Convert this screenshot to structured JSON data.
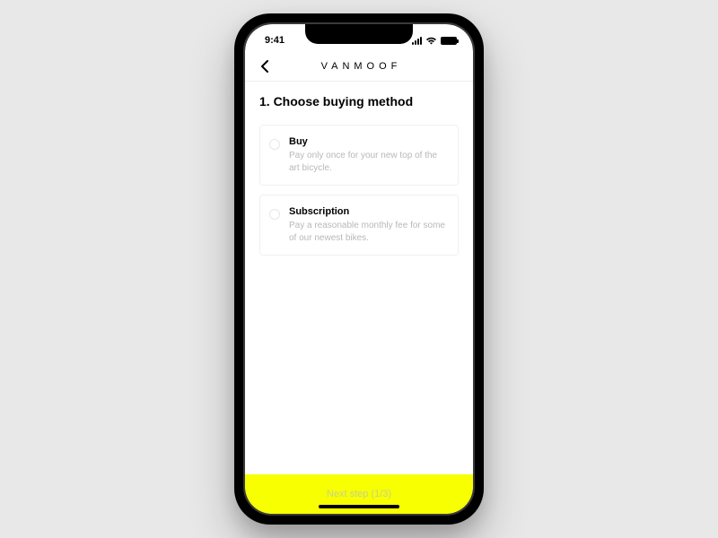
{
  "statusbar": {
    "time": "9:41"
  },
  "navbar": {
    "brand": "VANMOOF"
  },
  "page": {
    "title": "1. Choose buying method"
  },
  "options": [
    {
      "title": "Buy",
      "desc": "Pay only once for your new top of the art bicycle."
    },
    {
      "title": "Subscription",
      "desc": "Pay a reasonable monthly fee for some of our newest bikes."
    }
  ],
  "footer": {
    "label": "Next step (1/3)"
  }
}
